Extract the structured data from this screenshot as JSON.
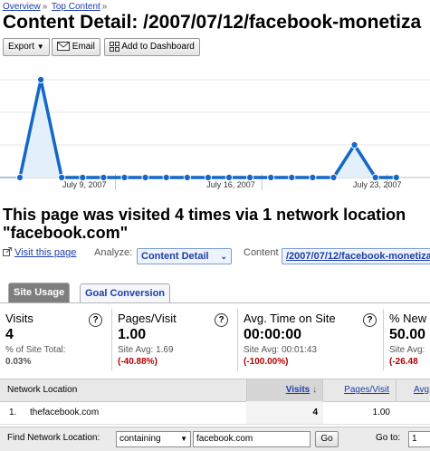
{
  "breadcrumb": {
    "items": [
      "Overview",
      "Top Content"
    ],
    "separator": "»"
  },
  "page_title": "Content Detail: /2007/07/12/facebook-monetiza",
  "toolbar": {
    "export_label": "Export",
    "email_label": "Email",
    "dashboard_label": "Add to Dashboard"
  },
  "chart": {
    "date_labels": [
      "July 9, 2007",
      "July 16, 2007",
      "July 23, 2007"
    ],
    "color": "#1467c8"
  },
  "chart_data": {
    "type": "area",
    "title": "",
    "xlabel": "",
    "ylabel": "",
    "tick_labels": [
      "July 9, 2007",
      "July 16, 2007",
      "July 23, 2007"
    ],
    "series": [
      {
        "values": [
          0,
          3,
          0,
          0,
          0,
          0,
          0,
          0,
          0,
          0,
          0,
          0,
          0,
          0,
          0,
          0,
          1,
          0,
          0
        ]
      }
    ],
    "ylim": [
      0,
      3
    ],
    "grid": true
  },
  "summary": {
    "line1": "This page was visited 4 times via 1 network location",
    "line2": "\"facebook.com\""
  },
  "analyze_row": {
    "visit_link": "Visit this page",
    "analyze_label": "Analyze:",
    "analyze_value": "Content Detail",
    "content_label": "Content",
    "content_value": "/2007/07/12/facebook-monetiza"
  },
  "tabs": [
    {
      "label": "Site Usage",
      "active": true
    },
    {
      "label": "Goal Conversion",
      "active": false
    }
  ],
  "scorecards": [
    {
      "label": "Visits",
      "value": "4",
      "sub1": "% of Site Total:",
      "sub2": "0.03%"
    },
    {
      "label": "Pages/Visit",
      "value": "1.00",
      "sub1": "Site Avg: 1.69",
      "sub2": "(-40.88%)"
    },
    {
      "label": "Avg. Time on Site",
      "value": "00:00:00",
      "sub1": "Site Avg: 00:01:43",
      "sub2": "(-100.00%)"
    },
    {
      "label": "% New",
      "value": "50.00",
      "sub1": "Site Avg:",
      "sub2": "(-26.48"
    }
  ],
  "table": {
    "headers": [
      "Network Location",
      "Visits",
      "Pages/Visit",
      "Avg"
    ],
    "rows": [
      {
        "index": "1.",
        "location": "thefacebook.com",
        "visits": "4",
        "pages_per_visit": "1.00"
      }
    ]
  },
  "find_bar": {
    "label": "Find Network Location:",
    "mode": "containing",
    "query": "facebook.com",
    "go_label": "Go",
    "goto_label": "Go to:",
    "goto_value": "1"
  }
}
